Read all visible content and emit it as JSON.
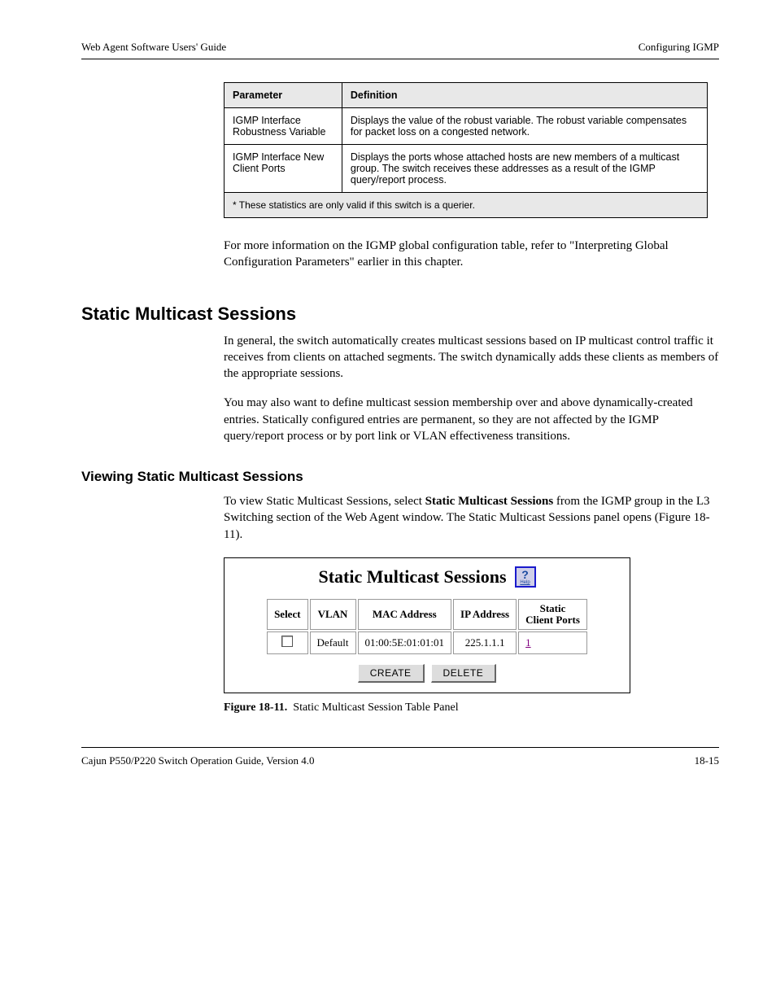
{
  "header": {
    "left": "Web Agent Software Users' Guide",
    "right": "Configuring IGMP"
  },
  "paramTable": {
    "columns": [
      "Parameter",
      "Definition"
    ],
    "rows": [
      {
        "param": "IGMP Interface Robustness Variable",
        "def": "Displays the value of the robust variable. The robust variable compensates for packet loss on a congested network."
      },
      {
        "param": "IGMP Interface New Client Ports",
        "def": "Displays the ports whose attached hosts are new members of a multicast group. The switch receives these addresses as a result of the IGMP query/report process."
      }
    ],
    "footnote": "* These statistics are only valid if this switch is a querier."
  },
  "para1": "For more information on the IGMP global configuration table, refer to \"Interpreting Global Configuration Parameters\" earlier in this chapter.",
  "h2": "Static Multicast Sessions",
  "para2a": "In general, the switch automatically creates multicast sessions based on IP multicast control traffic it receives from clients on attached segments. The switch dynamically adds these clients as members of the appropriate sessions.",
  "para2b": "You may also want to define multicast session membership over and above dynamically-created entries. Statically configured entries are permanent, so they are not affected by the IGMP query/report process or by port link or VLAN effectiveness transitions.",
  "h3": "Viewing Static Multicast Sessions",
  "para3_prefix": "To view Static Multicast Sessions, select ",
  "para3_bold": "Static Multicast Sessions",
  "para3_suffix": " from the IGMP group in the L3 Switching section of the Web Agent window. The Static Multicast Sessions panel opens (Figure 18-11).",
  "widget": {
    "title": "Static Multicast Sessions",
    "columns": [
      "Select",
      "VLAN",
      "MAC Address",
      "IP Address",
      "Static Client Ports"
    ],
    "row": {
      "vlan": "Default",
      "mac": "01:00:5E:01:01:01",
      "ip": "225.1.1.1",
      "ports_link": "1"
    },
    "buttons": {
      "create": "CREATE",
      "delete": "DELETE"
    }
  },
  "figureCaption": "Figure 18-11.  Static Multicast Session Table Panel",
  "footer": {
    "left": "Cajun P550/P220 Switch Operation Guide, Version 4.0",
    "right": "18-15"
  }
}
